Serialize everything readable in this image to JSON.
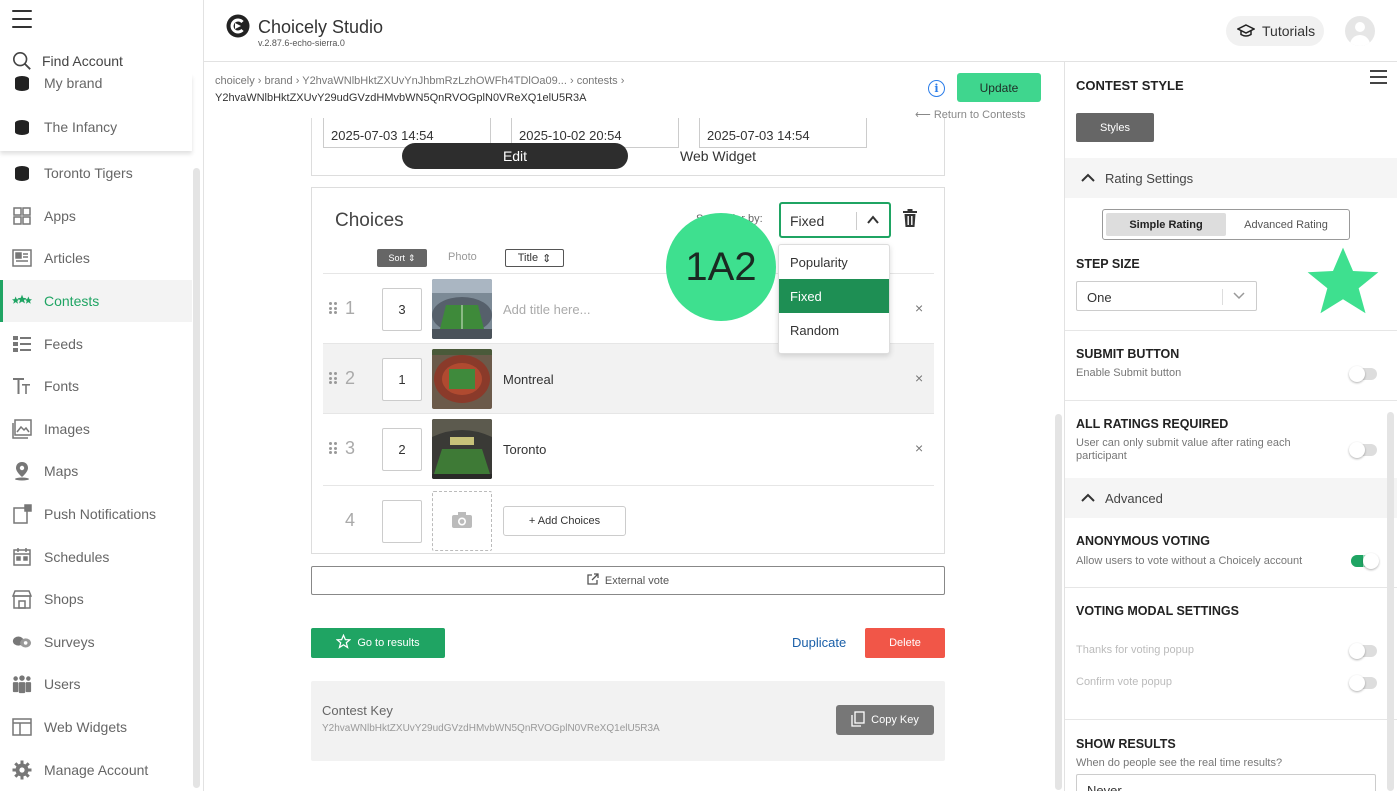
{
  "sidebar": {
    "find_account": "Find Account",
    "brands": [
      "My brand",
      "The Infancy",
      "Toronto Tigers"
    ],
    "items": [
      {
        "label": "Apps",
        "icon": "apps-icon"
      },
      {
        "label": "Articles",
        "icon": "articles-icon"
      },
      {
        "label": "Contests",
        "icon": "contests-icon",
        "active": true
      },
      {
        "label": "Feeds",
        "icon": "feeds-icon"
      },
      {
        "label": "Fonts",
        "icon": "fonts-icon"
      },
      {
        "label": "Images",
        "icon": "images-icon"
      },
      {
        "label": "Maps",
        "icon": "maps-icon"
      },
      {
        "label": "Push Notifications",
        "icon": "push-notifications-icon"
      },
      {
        "label": "Schedules",
        "icon": "schedules-icon"
      },
      {
        "label": "Shops",
        "icon": "shops-icon"
      },
      {
        "label": "Surveys",
        "icon": "surveys-icon"
      },
      {
        "label": "Users",
        "icon": "users-icon"
      },
      {
        "label": "Web Widgets",
        "icon": "web-widgets-icon"
      },
      {
        "label": "Manage Account",
        "icon": "gear-icon"
      }
    ]
  },
  "header": {
    "title": "Choicely Studio",
    "version": "v.2.87.6-echo-sierra.0",
    "tutorials": "Tutorials"
  },
  "main": {
    "breadcrumb": "choicely › brand › Y2hvaWNlbHktZXUvYnJhbmRzLzhOWFh4TDlOa09... › contests ›",
    "breadcrumb_id": "Y2hvaWNlbHktZXUvY29udGVzdHMvbWN5QnRVOGplN0VReXQ1elU5R3A",
    "update": "Update",
    "return": "Return to Contests",
    "dates": [
      "2025-07-03 14:54",
      "2025-10-02 20:54",
      "2025-07-03 14:54"
    ],
    "tabs": {
      "edit": "Edit",
      "widget": "Web Widget"
    },
    "choices": {
      "title": "Choices",
      "order_label": "Sort order by:",
      "order_value": "Fixed",
      "order_options": [
        "Popularity",
        "Fixed",
        "Random"
      ],
      "col_sort": "Sort",
      "col_photo": "Photo",
      "col_title": "Title",
      "rows": [
        {
          "num": "1",
          "sort": "3",
          "title": "Add title here...",
          "placeholder": true
        },
        {
          "num": "2",
          "sort": "1",
          "title": "Montreal"
        },
        {
          "num": "3",
          "sort": "2",
          "title": "Toronto"
        }
      ],
      "new_row_num": "4",
      "add_choices": "+ Add Choices"
    },
    "badge": "1A2",
    "external_vote": "External vote",
    "go_results": "Go to results",
    "duplicate": "Duplicate",
    "delete": "Delete",
    "key": {
      "title": "Contest Key",
      "value": "Y2hvaWNlbHktZXUvY29udGVzdHMvbWN5QnRVOGplN0VReXQ1elU5R3A",
      "copy": "Copy Key"
    }
  },
  "panel": {
    "title": "CONTEST STYLE",
    "styles": "Styles",
    "rating_settings": "Rating Settings",
    "simple_rating": "Simple Rating",
    "advanced_rating": "Advanced Rating",
    "step_size": "STEP SIZE",
    "step_value": "One",
    "submit_button": "SUBMIT BUTTON",
    "submit_sub": "Enable Submit button",
    "all_required": "ALL RATINGS REQUIRED",
    "all_required_sub": "User can only submit value after rating each participant",
    "advanced": "Advanced",
    "anonymous": "ANONYMOUS VOTING",
    "anonymous_sub": "Allow users to vote without a Choicely account",
    "modal": "VOTING MODAL SETTINGS",
    "thanks_popup": "Thanks for voting popup",
    "confirm_popup": "Confirm vote popup",
    "show_results": "SHOW RESULTS",
    "show_results_sub": "When do people see the real time results?",
    "show_results_value": "Never"
  },
  "colors": {
    "accent": "#1fa463",
    "update": "#3fd68e",
    "delete": "#f15648",
    "badge": "#3ee08f"
  }
}
